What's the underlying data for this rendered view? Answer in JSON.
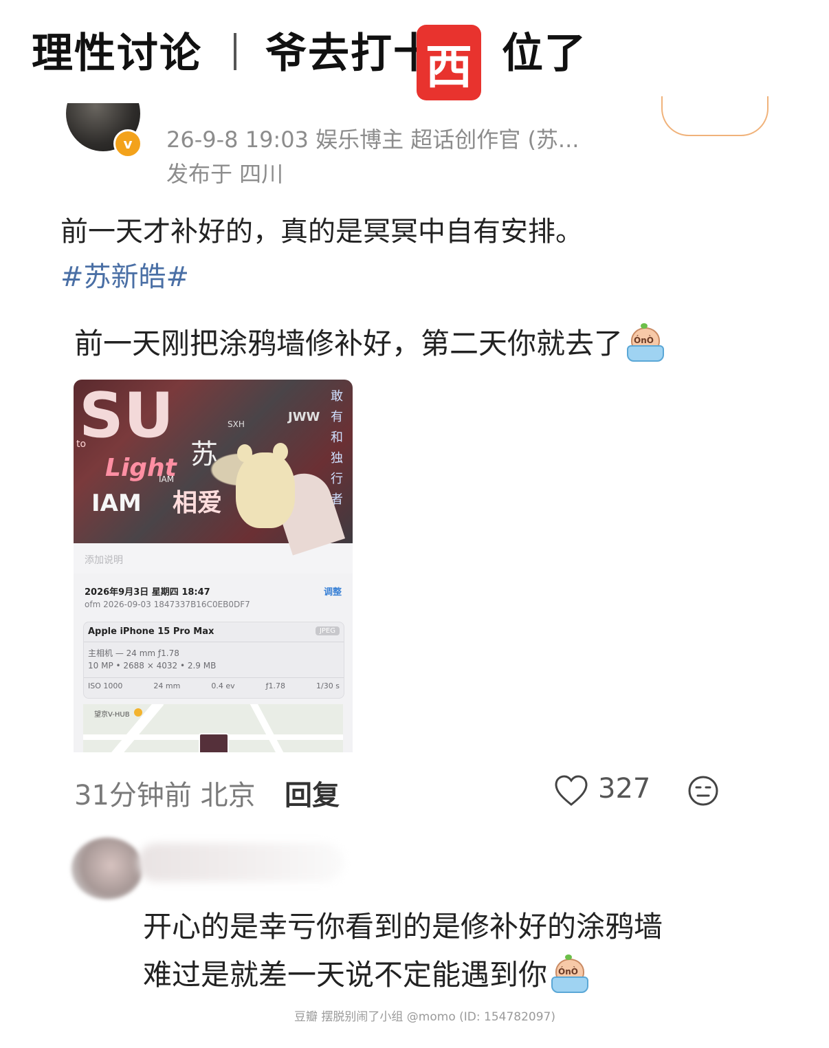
{
  "header": {
    "left_title": "理性讨论",
    "right_title_part1": "爷去打十",
    "badge": "西",
    "right_title_part2": "位了"
  },
  "post": {
    "badge_letter": "v",
    "meta_line": "26-9-8 19:03  娱乐博主 超话创作官 (苏...",
    "location_line": "发布于 四川",
    "text": "前一天才补好的，真的是冥冥中自有安排。",
    "hashtag": "#苏新皓#"
  },
  "quoted_comment": {
    "text": "前一天刚把涂鸦墙修补好，第二天你就去了",
    "emoji": "crying-in-bathtub",
    "emoji_face": "ÓnÒ",
    "image": {
      "graffiti_su": "SU",
      "graffiti_light": "Light",
      "graffiti_iam": "IAM",
      "graffiti_iam_small": "IAM",
      "graffiti_jww": "JWW",
      "graffiti_sxh": "SXH",
      "graffiti_to": "to",
      "graffiti_side": "敢有和独行者",
      "graffiti_chars": "相爱",
      "graffiti_chars2": "苏",
      "caption_placeholder": "添加说明",
      "date": "2026年9月3日 星期四 18:47",
      "adjust": "调整",
      "filename": "ofm 2026-09-03 1847337B16C0EB0DF7",
      "device": "Apple iPhone 15 Pro Max",
      "format": "JPEG",
      "lens": "主相机 — 24 mm ƒ1.78",
      "size": "10 MP • 2688 × 4032 • 2.9 MB",
      "exif": [
        "ISO 1000",
        "24 mm",
        "0.4 ev",
        "ƒ1.78",
        "1/30 s"
      ],
      "map_label": "望京V-HUB"
    },
    "time": "31分钟前",
    "location": "北京",
    "reply_label": "回复",
    "like_count": "327"
  },
  "second_comment": {
    "line1": "开心的是幸亏你看到的是修补好的涂鸦墙",
    "line2": "难过是就差一天说不定能遇到你",
    "emoji": "crying-in-bathtub",
    "emoji_face": "ÓnÒ"
  },
  "watermark": "豆瓣  摆脱别闹了小组 @momo (ID: 154782097)",
  "colors": {
    "badge_red": "#e8332e",
    "hashtag_blue": "#4a6fa5",
    "vip_orange": "#f3a21b"
  }
}
